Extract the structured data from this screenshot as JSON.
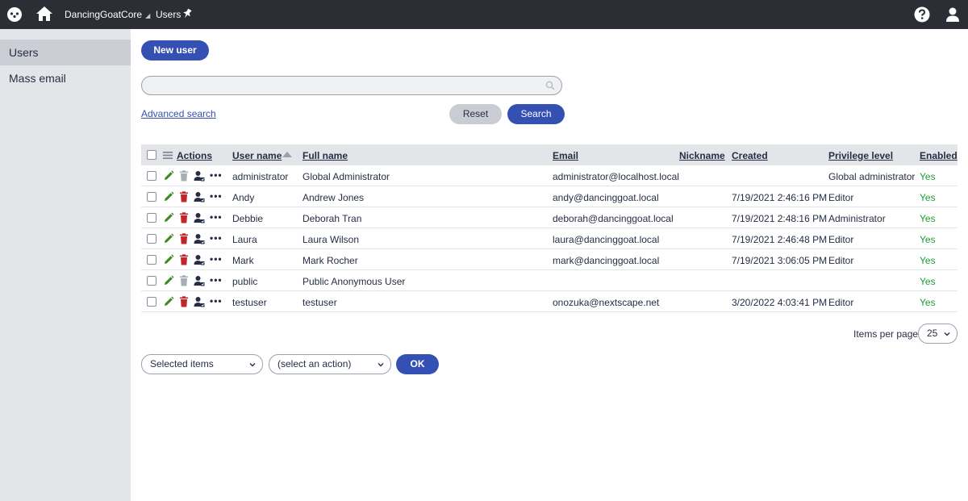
{
  "topbar": {
    "site_name": "DancingGoatCore",
    "site_caret": "◢",
    "app_name": "Users",
    "icons": [
      "logo-icon",
      "home-icon",
      "pin-icon",
      "help-icon",
      "user-icon"
    ]
  },
  "sidebar": {
    "items": [
      {
        "label": "Users",
        "active": true
      },
      {
        "label": "Mass email",
        "active": false
      }
    ]
  },
  "toolbar": {
    "new_user_label": "New user"
  },
  "search": {
    "value": "",
    "placeholder": "",
    "advanced_label": "Advanced search",
    "reset_label": "Reset",
    "search_label": "Search"
  },
  "grid": {
    "columns": {
      "actions": "Actions",
      "user_name": "User name",
      "full_name": "Full name",
      "email": "Email",
      "nickname": "Nickname",
      "created": "Created",
      "privilege": "Privilege level",
      "enabled": "Enabled"
    },
    "rows": [
      {
        "user_name": "administrator",
        "full_name": "Global Administrator",
        "email": "administrator@localhost.local",
        "nickname": "",
        "created": "",
        "privilege": "Global administrator",
        "enabled": "Yes",
        "deletable": false
      },
      {
        "user_name": "Andy",
        "full_name": "Andrew Jones",
        "email": "andy@dancinggoat.local",
        "nickname": "",
        "created": "7/19/2021 2:46:16 PM",
        "privilege": "Editor",
        "enabled": "Yes",
        "deletable": true
      },
      {
        "user_name": "Debbie",
        "full_name": "Deborah Tran",
        "email": "deborah@dancinggoat.local",
        "nickname": "",
        "created": "7/19/2021 2:48:16 PM",
        "privilege": "Administrator",
        "enabled": "Yes",
        "deletable": true
      },
      {
        "user_name": "Laura",
        "full_name": "Laura Wilson",
        "email": "laura@dancinggoat.local",
        "nickname": "",
        "created": "7/19/2021 2:46:48 PM",
        "privilege": "Editor",
        "enabled": "Yes",
        "deletable": true
      },
      {
        "user_name": "Mark",
        "full_name": "Mark Rocher",
        "email": "mark@dancinggoat.local",
        "nickname": "",
        "created": "7/19/2021 3:06:05 PM",
        "privilege": "Editor",
        "enabled": "Yes",
        "deletable": true
      },
      {
        "user_name": "public",
        "full_name": "Public Anonymous User",
        "email": "",
        "nickname": "",
        "created": "",
        "privilege": "",
        "enabled": "Yes",
        "deletable": false
      },
      {
        "user_name": "testuser",
        "full_name": "testuser",
        "email": "onozuka@nextscape.net",
        "nickname": "",
        "created": "3/20/2022 4:03:41 PM",
        "privilege": "Editor",
        "enabled": "Yes",
        "deletable": true
      }
    ],
    "more_label": "•••"
  },
  "pager": {
    "items_per_page_label": "Items per page",
    "items_per_page_value": "25"
  },
  "mass_action": {
    "scope_value": "Selected items",
    "action_value": "(select an action)",
    "ok_label": "OK"
  },
  "colors": {
    "primary": "#3550b3",
    "topbar": "#2b2e35",
    "sidebar": "#e4e5e9",
    "edit": "#3c8a1e",
    "delete": "#c3262a",
    "disabled": "#a9adb5",
    "yes": "#1c9f2d"
  }
}
